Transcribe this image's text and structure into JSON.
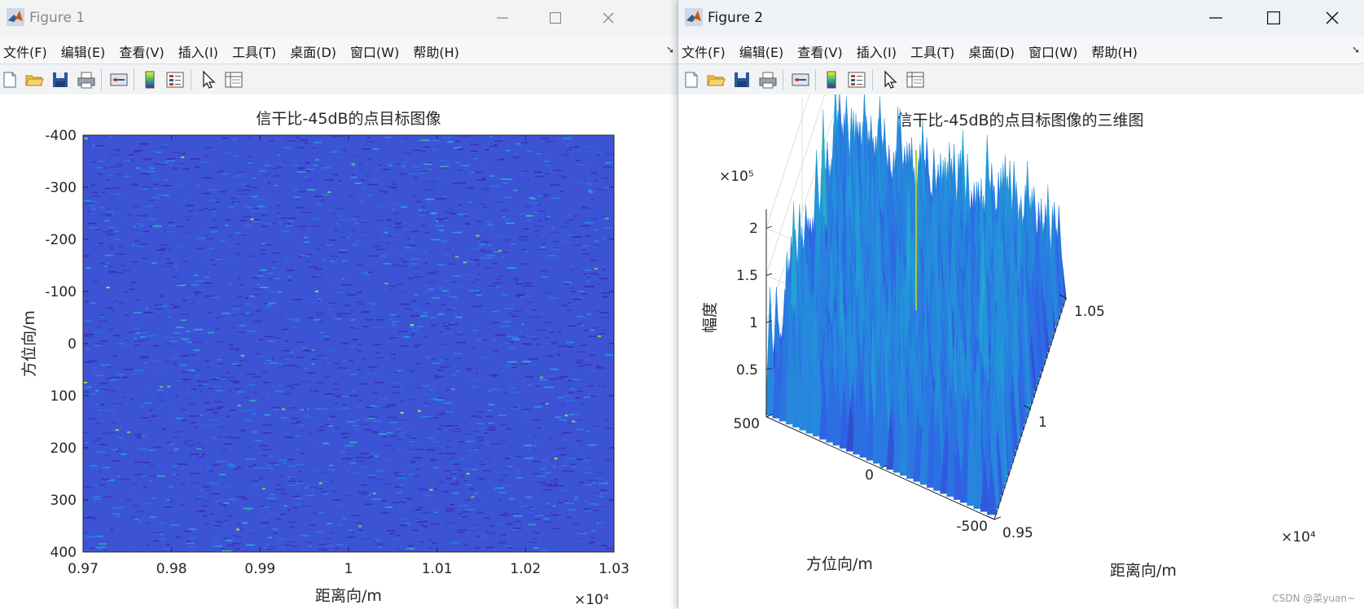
{
  "menu": [
    "文件(F)",
    "编辑(E)",
    "查看(V)",
    "插入(I)",
    "工具(T)",
    "桌面(D)",
    "窗口(W)",
    "帮助(H)"
  ],
  "toolbar_icons": [
    "new-figure-icon",
    "open-file-icon",
    "save-icon",
    "print-icon",
    "link-plot-icon",
    "colorbar-icon",
    "legend-icon",
    "pointer-icon",
    "property-inspector-icon"
  ],
  "window1": {
    "title": "Figure 1",
    "plot_title": "信干比-45dB的点目标图像",
    "xlabel": "距离向/m",
    "ylabel": "方位向/m",
    "x_exponent": "×10⁴",
    "x_ticks": [
      "0.97",
      "0.98",
      "0.99",
      "1",
      "1.01",
      "1.02",
      "1.03"
    ],
    "y_ticks": [
      "-400",
      "-300",
      "-200",
      "-100",
      "0",
      "100",
      "200",
      "300",
      "400"
    ]
  },
  "window2": {
    "title": "Figure 2",
    "plot_title": "信干比-45dB的点目标图像的三维图",
    "xlabel": "距离向/m",
    "ylabel": "方位向/m",
    "zlabel": "幅度",
    "z_exponent": "×10⁵",
    "x_exponent": "×10⁴",
    "x_ticks": [
      "0.95",
      "1",
      "1.05"
    ],
    "y_ticks": [
      "-500",
      "0",
      "500"
    ],
    "z_ticks": [
      "0.5",
      "1",
      "1.5",
      "2"
    ]
  },
  "watermark": "CSDN @菜yuan~",
  "colors": {
    "parula_low": "#3e26a8",
    "parula_mid": "#2f63e6",
    "parula_high": "#31b8bb",
    "peak": "#a8c93c"
  },
  "chart_data": [
    {
      "type": "heatmap",
      "title": "信干比-45dB的点目标图像",
      "xlabel": "距离向/m",
      "ylabel": "方位向/m",
      "xlim": [
        9700,
        10300
      ],
      "ylim": [
        -400,
        400
      ],
      "y_reversed": true,
      "x_multiplier": "×10^4",
      "colormap": "parula",
      "note_values": "noise-dominated magnitude, point target buried at -45 dB SIR"
    },
    {
      "type": "surface3d",
      "title": "信干比-45dB的点目标图像的三维图",
      "xlabel": "距离向/m",
      "ylabel": "方位向/m",
      "zlabel": "幅度",
      "xlim": [
        9500,
        10500
      ],
      "ylim": [
        -500,
        500
      ],
      "zlim": [
        0,
        220000
      ],
      "z_multiplier": "×10^5",
      "x_multiplier": "×10^4",
      "colormap": "parula"
    }
  ]
}
